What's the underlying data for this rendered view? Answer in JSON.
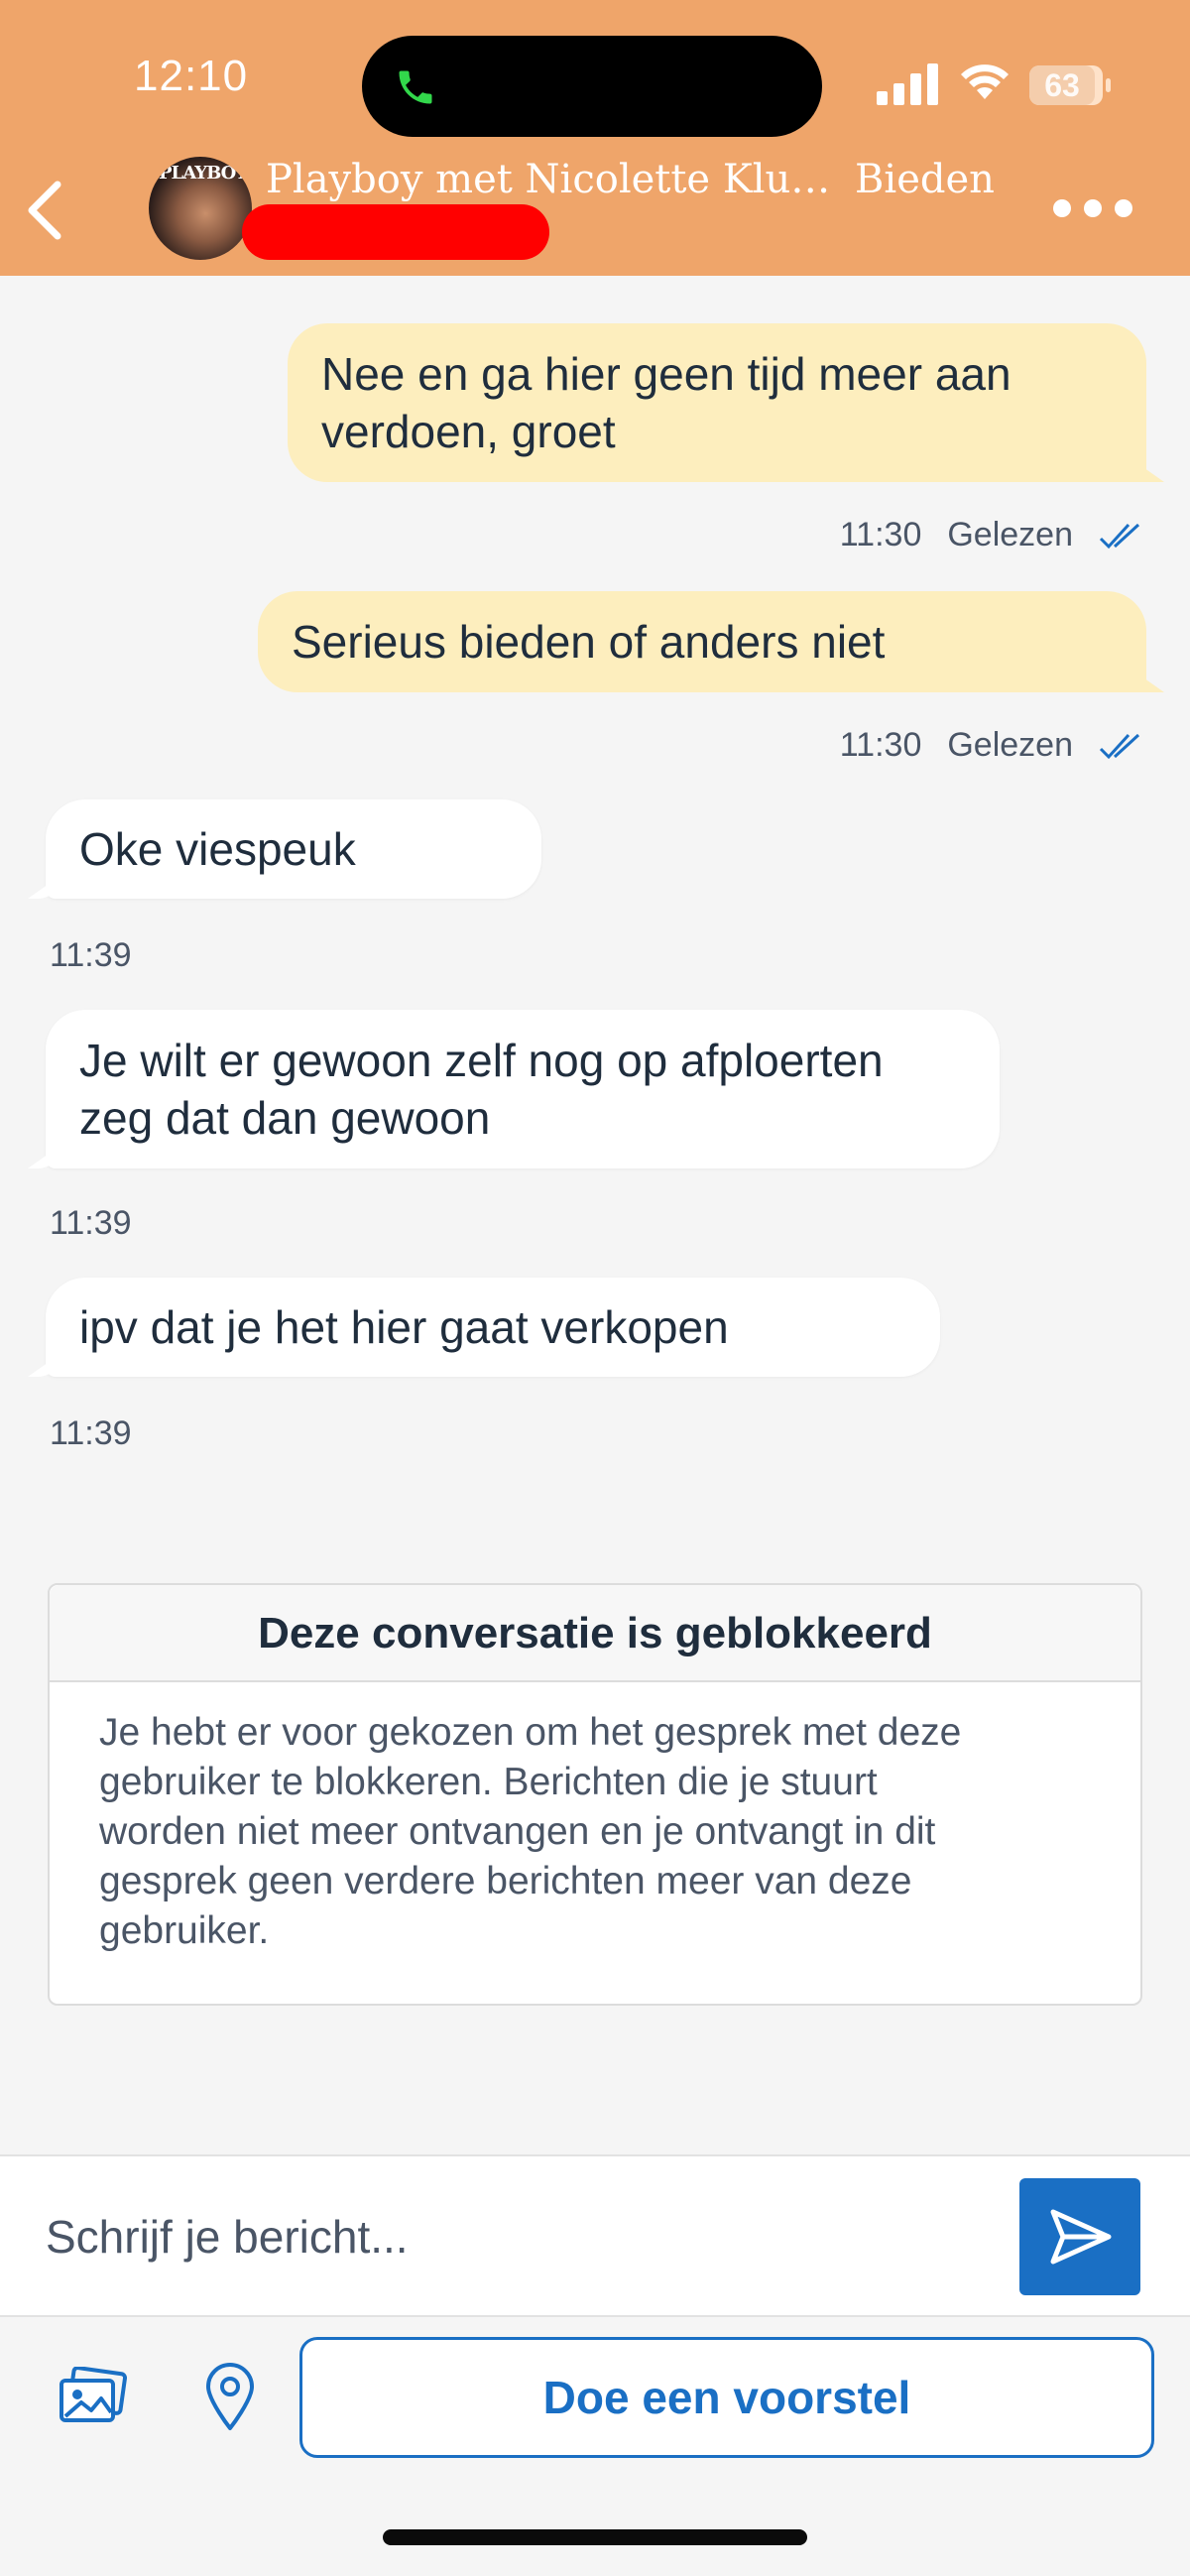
{
  "status_bar": {
    "time": "12:10",
    "battery": "63"
  },
  "header": {
    "title": "Playboy met Nicolette Kluijver",
    "action": "Bieden",
    "avatar_text": "PLAYBOY"
  },
  "messages": [
    {
      "direction": "out",
      "lines": [
        "Nee en ga hier geen tijd meer aan",
        "verdoen, groet"
      ],
      "time": "11:30",
      "status": "Gelezen"
    },
    {
      "direction": "out",
      "lines": [
        "Serieus bieden of anders niet"
      ],
      "time": "11:30",
      "status": "Gelezen"
    },
    {
      "direction": "in",
      "lines": [
        "Oke viespeuk"
      ],
      "time": "11:39"
    },
    {
      "direction": "in",
      "lines": [
        "Je wilt er gewoon zelf nog op afploerten",
        "zeg dat dan gewoon"
      ],
      "time": "11:39"
    },
    {
      "direction": "in",
      "lines": [
        "ipv dat je het hier gaat verkopen"
      ],
      "time": "11:39"
    }
  ],
  "blocked_notice": {
    "title": "Deze conversatie is geblokkeerd",
    "lines": [
      "Je hebt er voor gekozen om het gesprek met deze",
      "gebruiker te blokkeren. Berichten die je stuurt",
      "worden niet meer ontvangen en je ontvangt in dit",
      "gesprek geen verdere berichten meer van deze",
      "gebruiker."
    ]
  },
  "composer": {
    "placeholder": "Schrijf je bericht...",
    "value": ""
  },
  "toolbar": {
    "offer_label": "Doe een voorstel"
  },
  "icons": {
    "back": "chevron-left-icon",
    "more": "more-horizontal-icon",
    "send": "send-icon",
    "photo": "photo-icon",
    "location": "location-pin-icon",
    "read": "double-check-icon",
    "call": "phone-icon"
  },
  "colors": {
    "header": "#efa56a",
    "outgoing_bubble": "#fdeebe",
    "incoming_bubble": "#ffffff",
    "accent": "#1a6fc4",
    "background": "#f5f5f5"
  }
}
